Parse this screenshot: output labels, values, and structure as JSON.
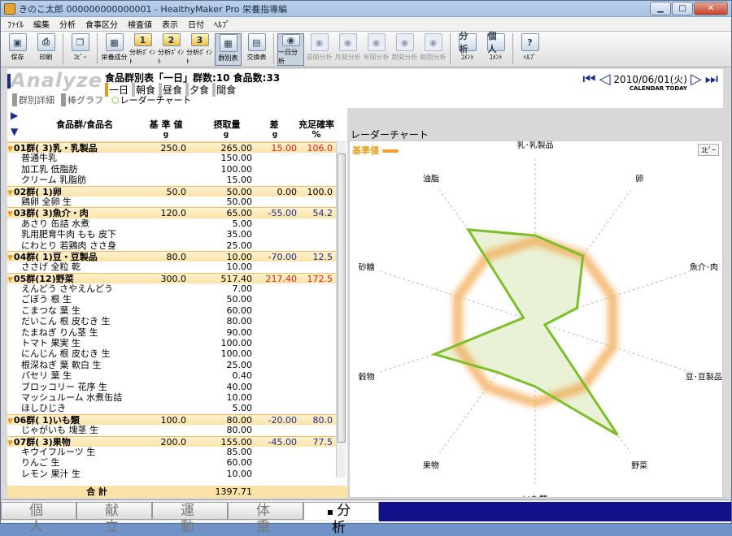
{
  "window": {
    "title": "きのこ太郎 000000000000001 - HealthyMaker Pro 栄養指導編"
  },
  "menu": [
    "ﾌｧｲﾙ",
    "編集",
    "分析",
    "食事区分",
    "検査値",
    "表示",
    "日付",
    "ﾍﾙﾌﾟ"
  ],
  "toolbar": {
    "save": "保存",
    "print": "印刷",
    "copy": "ｺﾋﾟｰ",
    "nutrient": "栄養成分",
    "bal1": "分析ﾎﾟｲﾝﾄ",
    "bal2": "分析ﾎﾟｲﾝﾄ",
    "bal3": "分析ﾎﾟｲﾝﾄ",
    "group": "群別表",
    "exchange": "交換表",
    "day": "一日分析",
    "week": "週間分析",
    "month": "月間分析",
    "year": "年間分析",
    "period": "期間分析",
    "range": "範囲分析",
    "analysis": "ｺﾒﾝﾄ",
    "personal": "ｺﾒﾝﾄ",
    "help": "ﾍﾙﾌﾟ",
    "num1": "1",
    "num2": "2",
    "num3": "3",
    "an_ic": "分析",
    "per_ic": "個人",
    "help_ic": "?"
  },
  "header": {
    "logo": "Analyze",
    "title": "食品群別表「一日」群数:10 食品数:33",
    "meals": [
      "一日",
      "朝食",
      "昼食",
      "夕食",
      "間食"
    ],
    "date": "2010/06/01(火)",
    "date_sub": "CALENDAR  TODAY",
    "subtabs": [
      "群別詳細",
      "棒グラフ",
      "レーダーチャート"
    ]
  },
  "table": {
    "col_name": "食品群/食品名",
    "col_std": "基 準 値",
    "col_std_unit": "g",
    "col_intake": "摂取量",
    "col_intake_unit": "g",
    "col_diff": "差",
    "col_diff_unit": "g",
    "col_rate": "充足確率",
    "col_rate_unit": "%",
    "rows": [
      {
        "type": "grp",
        "name": "01群( 3)乳・乳製品",
        "std": "250.0",
        "intake": "265.00",
        "diff": "15.00",
        "rate": "106.0",
        "dc": "red",
        "rc": "red"
      },
      {
        "type": "item",
        "name": "普通牛乳",
        "intake": "150.00"
      },
      {
        "type": "item",
        "name": "加工乳 低脂肪",
        "intake": "100.00"
      },
      {
        "type": "item",
        "name": "クリーム 乳脂肪",
        "intake": "15.00"
      },
      {
        "type": "grp",
        "name": "02群( 1)卵",
        "std": "50.0",
        "intake": "50.00",
        "diff": "0.00",
        "rate": "100.0",
        "dc": "",
        "rc": ""
      },
      {
        "type": "item",
        "name": "鶏卵 全卵 生",
        "intake": "50.00"
      },
      {
        "type": "grp",
        "name": "03群( 3)魚介・肉",
        "std": "120.0",
        "intake": "65.00",
        "diff": "-55.00",
        "rate": "54.2",
        "dc": "blue",
        "rc": "blue"
      },
      {
        "type": "item",
        "name": "あさり 缶詰 水煮",
        "intake": "5.00"
      },
      {
        "type": "item",
        "name": "乳用肥育牛肉 もも 皮下",
        "intake": "35.00"
      },
      {
        "type": "item",
        "name": "にわとり 若鶏肉 ささ身",
        "intake": "25.00"
      },
      {
        "type": "grp",
        "name": "04群( 1)豆・豆製品",
        "std": "80.0",
        "intake": "10.00",
        "diff": "-70.00",
        "rate": "12.5",
        "dc": "blue",
        "rc": "blue"
      },
      {
        "type": "item",
        "name": "ささげ 全粒 乾",
        "intake": "10.00"
      },
      {
        "type": "grp",
        "name": "05群(12)野菜",
        "std": "300.0",
        "intake": "517.40",
        "diff": "217.40",
        "rate": "172.5",
        "dc": "red",
        "rc": "red"
      },
      {
        "type": "item",
        "name": "えんどう さやえんどう",
        "intake": "7.00"
      },
      {
        "type": "item",
        "name": "ごぼう 根 生",
        "intake": "50.00"
      },
      {
        "type": "item",
        "name": "こまつな 葉 生",
        "intake": "60.00"
      },
      {
        "type": "item",
        "name": "だいこん 根 皮むき 生",
        "intake": "80.00"
      },
      {
        "type": "item",
        "name": "たまねぎ りん茎 生",
        "intake": "90.00"
      },
      {
        "type": "item",
        "name": "トマト 果実 生",
        "intake": "100.00"
      },
      {
        "type": "item",
        "name": "にんじん 根 皮むき 生",
        "intake": "100.00"
      },
      {
        "type": "item",
        "name": "根深ねぎ 葉 軟白 生",
        "intake": "25.00"
      },
      {
        "type": "item",
        "name": "パセリ 葉 生",
        "intake": "0.40"
      },
      {
        "type": "item",
        "name": "ブロッコリー 花序 生",
        "intake": "40.00"
      },
      {
        "type": "item",
        "name": "マッシュルーム 水煮缶詰",
        "intake": "10.00"
      },
      {
        "type": "item",
        "name": "ほしひじき",
        "intake": "5.00"
      },
      {
        "type": "grp",
        "name": "06群( 1)いも類",
        "std": "100.0",
        "intake": "80.00",
        "diff": "-20.00",
        "rate": "80.0",
        "dc": "blue",
        "rc": "blue"
      },
      {
        "type": "item",
        "name": "じゃがいも 塊茎 生",
        "intake": "80.00"
      },
      {
        "type": "grp",
        "name": "07群( 3)果物",
        "std": "200.0",
        "intake": "155.00",
        "diff": "-45.00",
        "rate": "77.5",
        "dc": "blue",
        "rc": "blue"
      },
      {
        "type": "item",
        "name": "キウイフルーツ 生",
        "intake": "85.00"
      },
      {
        "type": "item",
        "name": "りんご 生",
        "intake": "60.00"
      },
      {
        "type": "item",
        "name": "レモン 果汁 生",
        "intake": "10.00"
      }
    ],
    "total_label": "合 計",
    "total_value": "1397.71"
  },
  "chart_title": "レーダーチャート",
  "chart_legend": "基準値",
  "chart_copy": "ｺﾋﾟｰ",
  "chart_data": {
    "type": "radar",
    "categories": [
      "乳･乳製品",
      "卵",
      "魚介･肉",
      "豆･豆製品",
      "野菜",
      "いも類",
      "果物",
      "穀物",
      "砂糖",
      "油脂"
    ],
    "series": [
      {
        "name": "基準値",
        "values": [
          100,
          100,
          100,
          100,
          100,
          100,
          100,
          100,
          100,
          100
        ]
      },
      {
        "values": [
          106.0,
          100.0,
          54.2,
          12.5,
          172.5,
          80.0,
          77.5,
          130,
          15,
          140
        ]
      }
    ],
    "colors": {
      "standard": "#f2ab55",
      "intake": "#7cbf2a",
      "fill": "#e9f2d6"
    }
  },
  "bottom_tabs": [
    "個 人",
    "献 立",
    "運 動",
    "体 重",
    "分 析"
  ]
}
